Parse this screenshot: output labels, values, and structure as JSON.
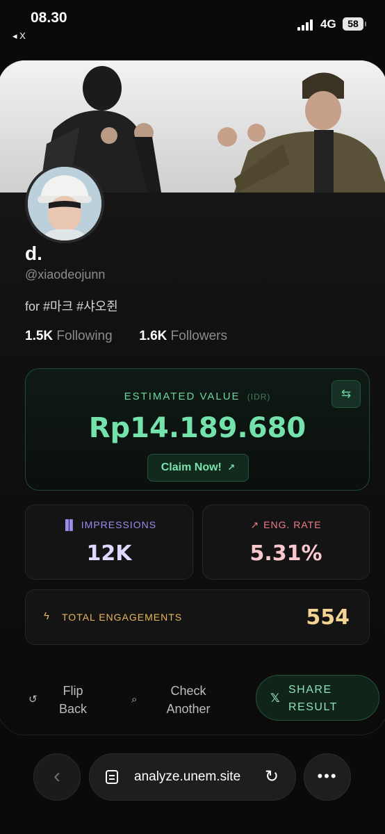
{
  "status_bar": {
    "time": "08.30",
    "back_app": "◂ X",
    "network": "4G",
    "battery": "58"
  },
  "profile": {
    "display_name": "d.",
    "handle": "@xiaodeojunn",
    "bio": "for #마크 #샤오쥔",
    "following_count": "1.5K",
    "following_label": "Following",
    "followers_count": "1.6K",
    "followers_label": "Followers"
  },
  "estimate": {
    "label": "ESTIMATED VALUE",
    "currency": "(IDR)",
    "amount": "Rp14.189.680",
    "claim_label": "Claim Now!"
  },
  "metrics": {
    "impressions_label": "IMPRESSIONS",
    "impressions_value": "12K",
    "eng_rate_label": "ENG. RATE",
    "eng_rate_value": "5.31%",
    "total_label": "TOTAL ENGAGEMENTS",
    "total_value": "554"
  },
  "actions": {
    "flip_label": "Flip Back",
    "check_label": "Check Another",
    "share_label": "SHARE RESULT"
  },
  "browser": {
    "url": "analyze.unem.site"
  },
  "colors": {
    "accent_green": "#74e3ab",
    "impressions_purple": "#9c8cf0",
    "eng_rate_pink": "#f07c8a",
    "engagements_gold": "#e9b65a"
  }
}
